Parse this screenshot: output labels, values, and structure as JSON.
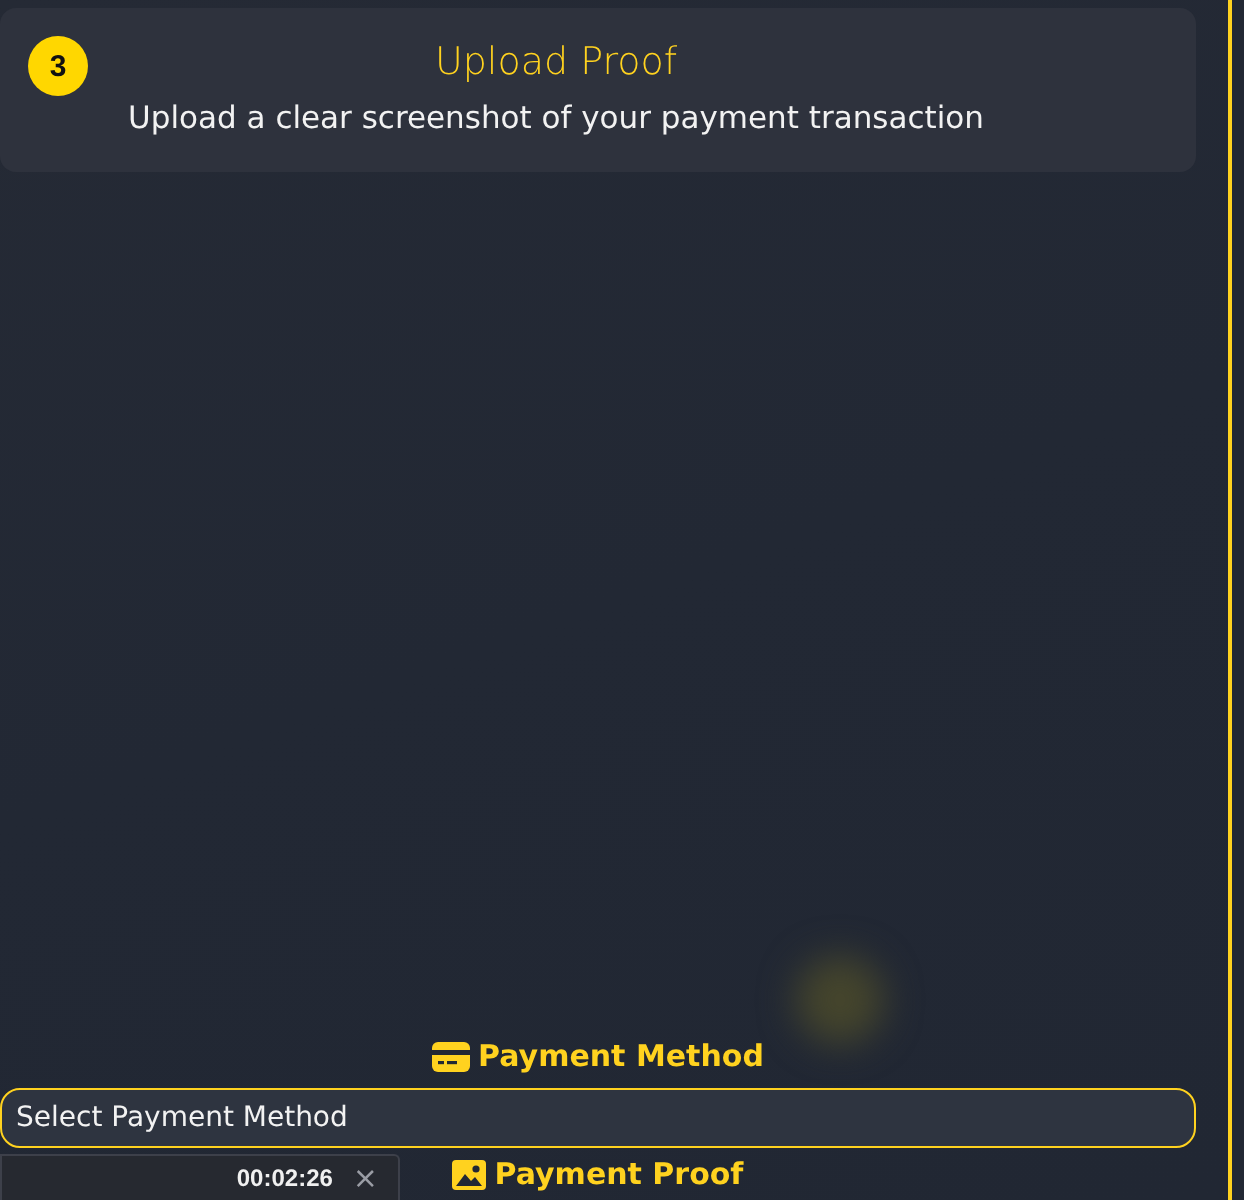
{
  "step": {
    "number": "3",
    "title": "Upload Proof",
    "subtitle": "Upload a clear screenshot of your payment transaction"
  },
  "payment_method": {
    "heading": "Payment Method",
    "select": {
      "value": "Select Payment Method"
    }
  },
  "payment_proof": {
    "heading": "Payment Proof"
  },
  "timer": {
    "time": "00:02:26",
    "close": "×"
  }
}
